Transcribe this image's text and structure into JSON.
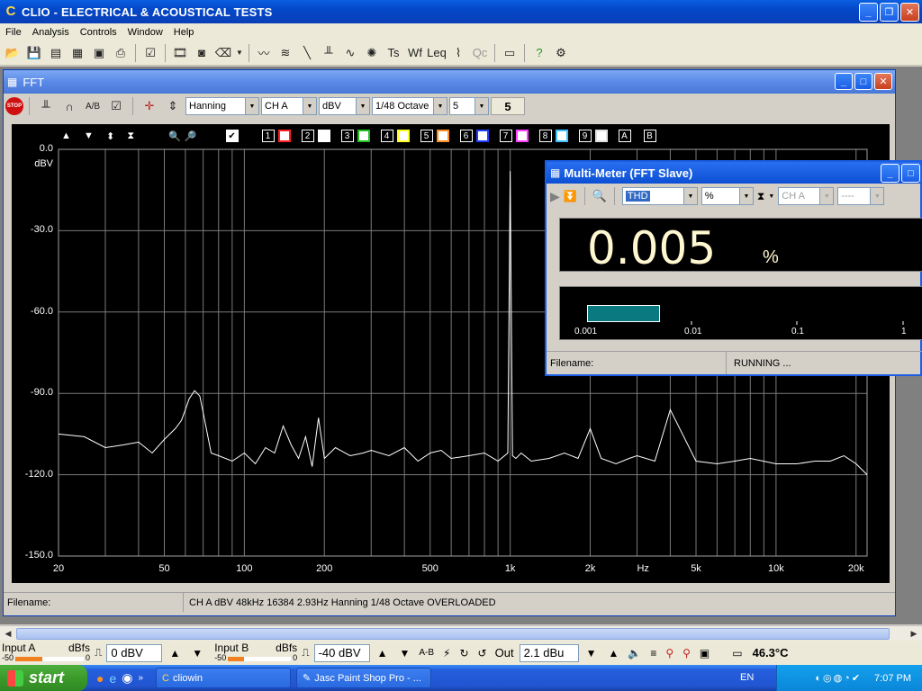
{
  "app": {
    "title": "CLIO - ELECTRICAL & ACOUSTICAL TESTS"
  },
  "menu": [
    "File",
    "Analysis",
    "Controls",
    "Window",
    "Help"
  ],
  "fft": {
    "title": "FFT",
    "window_select": "Hanning",
    "channel_select": "CH A",
    "unit_select": "dBV",
    "smoothing_select": "1/48 Octave",
    "averages_select": "5",
    "averages_display": "5",
    "status_filename_label": "Filename:",
    "status_info": "CH A   dBV   48kHz   16384   2.93Hz   Hanning   1/48 Octave   OVERLOADED",
    "memory_labels": [
      "1",
      "2",
      "3",
      "4",
      "5",
      "6",
      "7",
      "8",
      "9",
      "A",
      "B"
    ],
    "memory_colors": [
      "#ff2020",
      "#ffffff",
      "#20c020",
      "#ffff20",
      "#ff9020",
      "#2040ff",
      "#ff40ff",
      "#40c0ff",
      "#e0e0e0"
    ]
  },
  "chart_data": {
    "type": "line",
    "title": "",
    "xlabel": "Hz",
    "ylabel": "dBV",
    "x_scale": "log",
    "xlim": [
      20,
      22000
    ],
    "ylim": [
      -150,
      0
    ],
    "y_ticks": [
      "0.0",
      "-30.0",
      "-60.0",
      "-90.0",
      "-120.0",
      "-150.0"
    ],
    "x_ticks": [
      "20",
      "50",
      "100",
      "200",
      "500",
      "1k",
      "2k",
      "Hz",
      "5k",
      "10k",
      "20k"
    ],
    "grid": true,
    "series": [
      {
        "color": "#ffffff",
        "x": [
          20,
          25,
          30,
          35,
          40,
          45,
          50,
          55,
          58,
          60,
          62,
          65,
          68,
          70,
          75,
          80,
          90,
          100,
          110,
          120,
          130,
          140,
          150,
          160,
          170,
          180,
          190,
          200,
          220,
          250,
          280,
          300,
          350,
          400,
          450,
          500,
          550,
          600,
          700,
          800,
          900,
          980,
          1000,
          1020,
          1050,
          1100,
          1200,
          1400,
          1600,
          1800,
          2000,
          2200,
          2500,
          2800,
          3000,
          3500,
          4000,
          5000,
          6000,
          7000,
          8000,
          10000,
          12000,
          14000,
          16000,
          18000,
          20000,
          22000
        ],
        "y": [
          -105,
          -106,
          -110,
          -109,
          -108,
          -112,
          -107,
          -103,
          -100,
          -96,
          -92,
          -89,
          -91,
          -97,
          -112,
          -113,
          -115,
          -112,
          -116,
          -110,
          -112,
          -102,
          -109,
          -114,
          -106,
          -117,
          -99,
          -114,
          -110,
          -113,
          -112,
          -111,
          -113,
          -110,
          -115,
          -112,
          -111,
          -114,
          -113,
          -112,
          -115,
          -112,
          -8,
          -113,
          -114,
          -112,
          -115,
          -114,
          -112,
          -114,
          -103,
          -114,
          -116,
          -114,
          -113,
          -115,
          -96,
          -115,
          -116,
          -115,
          -114,
          -116,
          -116,
          -115,
          -115,
          -113,
          -116,
          -120
        ]
      }
    ]
  },
  "multimeter": {
    "title": "Multi-Meter (FFT Slave)",
    "param_select": "THD",
    "unit_select": "%",
    "channel_select": "CH A",
    "extra_select": "----",
    "value": "0.005",
    "unit": "%",
    "bar_fraction": 0.23,
    "scale_labels": [
      "0.001",
      "0.01",
      "0.1",
      "1"
    ],
    "status_filename_label": "Filename:",
    "status_text": "RUNNING ..."
  },
  "controls": {
    "input_a_label": "Input A",
    "input_b_label": "Input B",
    "dbfs_label": "dBfs",
    "scale_min": "-50",
    "scale_max": "0",
    "input_a_value": "0 dBV",
    "input_b_value": "-40 dBV",
    "ab_label": "A-B",
    "out_label": "Out",
    "out_value": "2.1 dBu",
    "temperature": "46.3°C"
  },
  "taskbar": {
    "start": "start",
    "tasks": [
      "cliowin",
      "Jasc Paint Shop Pro - ..."
    ],
    "language": "EN",
    "clock": "7:07 PM"
  }
}
